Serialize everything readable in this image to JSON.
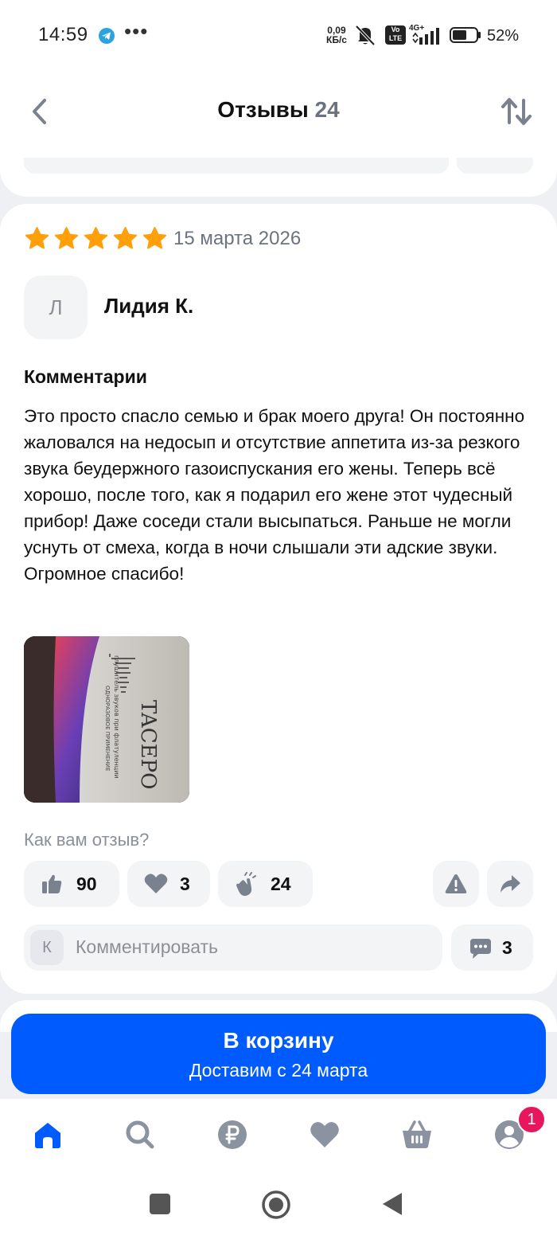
{
  "status_bar": {
    "time": "14:59",
    "net_speed_value": "0,09",
    "net_speed_unit": "КБ/с",
    "volte_top": "Vo",
    "volte_bottom": "LTE",
    "network": "4G+",
    "battery": "52%"
  },
  "header": {
    "title": "Отзывы",
    "count": "24",
    "back_icon": "chevron-left-icon",
    "sort_icon": "sort-arrows-icon"
  },
  "review": {
    "rating": 5,
    "date": "15 марта 2026",
    "avatar_letter": "Л",
    "author": "Лидия К.",
    "section_label": "Комментарии",
    "text": "Это просто спасло семью и брак моего друга!  Он постоянно жаловался на недосып и отсутствие аппетита из-за резкого звука беудержного газоиспускания его жены. Теперь всё хорошо, после того, как я подарил его жене этот чудесный прибор! Даже соседи стали высыпаться. Раньше не могли уснуть от смеха, когда в ночи слышали эти адские звуки. Огромное спасибо!",
    "photo": {
      "brand": "TACEPO",
      "line1": "глушитель звуков при флатуленции",
      "line2": "ОДНОРАЗОВОЕ ПРИМЕНЕНИЕ"
    },
    "reaction_prompt": "Как вам отзыв?",
    "reactions": {
      "likes": "90",
      "hearts": "3",
      "claps": "24"
    },
    "comment": {
      "avatar_letter": "К",
      "placeholder": "Комментировать",
      "count": "3"
    }
  },
  "cart_button": {
    "label": "В корзину",
    "sub": "Доставим с 24 марта"
  },
  "bottom_nav": {
    "items": [
      "home-icon",
      "search-icon",
      "ruble-icon",
      "heart-icon",
      "basket-icon",
      "profile-icon"
    ],
    "active": "home-icon",
    "profile_badge": "1"
  },
  "colors": {
    "accent": "#005bff",
    "star": "#ff9f0a",
    "badge": "#e6175c"
  }
}
